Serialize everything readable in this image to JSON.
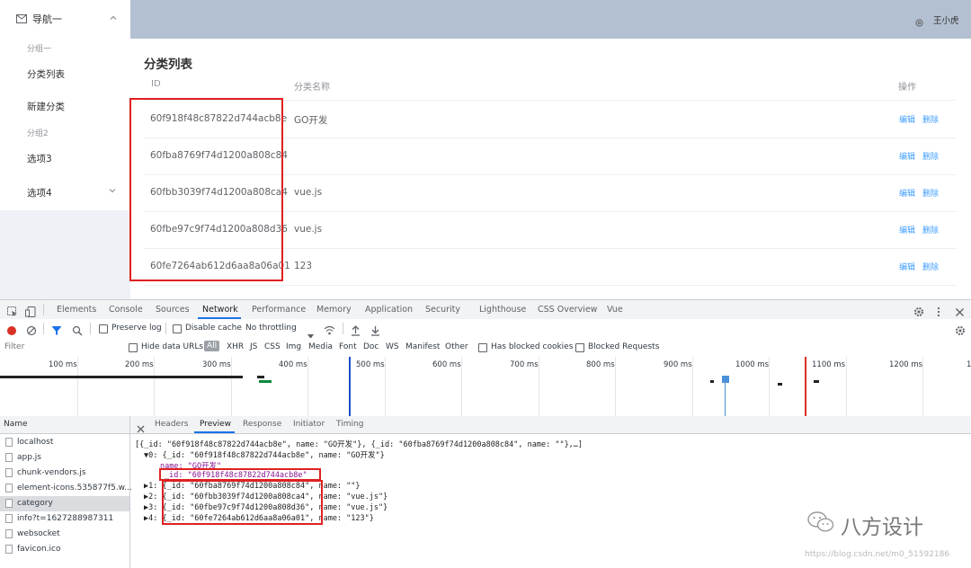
{
  "sidebar": {
    "nav_title": "导航一",
    "group1": "分组一",
    "item_list": "分类列表",
    "item_new": "新建分类",
    "group2": "分组2",
    "item_opt3": "选项3",
    "item_opt4": "选项4"
  },
  "header": {
    "user": "王小虎"
  },
  "main": {
    "title": "分类列表",
    "col_id": "ID",
    "col_name": "分类名称",
    "col_ops": "操作",
    "edit": "编辑",
    "delete": "删除",
    "rows": [
      {
        "id": "60f918f48c87822d744acb8e",
        "name": "GO开发"
      },
      {
        "id": "60fba8769f74d1200a808c84",
        "name": ""
      },
      {
        "id": "60fbb3039f74d1200a808ca4",
        "name": "vue.js"
      },
      {
        "id": "60fbe97c9f74d1200a808d36",
        "name": "vue.js"
      },
      {
        "id": "60fe7264ab612d6aa8a06a01",
        "name": "123"
      }
    ]
  },
  "devtools": {
    "tabs": [
      "Elements",
      "Console",
      "Sources",
      "Network",
      "Performance",
      "Memory",
      "Application",
      "Security",
      "Lighthouse",
      "CSS Overview",
      "Vue"
    ],
    "active_tab": "Network",
    "preserve_log": "Preserve log",
    "disable_cache": "Disable cache",
    "throttling": "No throttling",
    "filter_placeholder": "Filter",
    "hide_data_urls": "Hide data URLs",
    "types": [
      "All",
      "XHR",
      "JS",
      "CSS",
      "Img",
      "Media",
      "Font",
      "Doc",
      "WS",
      "Manifest",
      "Other"
    ],
    "has_blocked_cookies": "Has blocked cookies",
    "blocked_requests": "Blocked Requests",
    "ticks": [
      "100 ms",
      "200 ms",
      "300 ms",
      "400 ms",
      "500 ms",
      "600 ms",
      "700 ms",
      "800 ms",
      "900 ms",
      "1000 ms",
      "1100 ms",
      "1200 ms",
      "1"
    ],
    "name_header": "Name",
    "requests": [
      "localhost",
      "app.js",
      "chunk-vendors.js",
      "element-icons.535877f5.w...",
      "category",
      "info?t=1627288987311",
      "websocket",
      "favicon.ico"
    ],
    "selected_request": "category",
    "preview_tabs": [
      "Headers",
      "Preview",
      "Response",
      "Initiator",
      "Timing"
    ],
    "active_preview_tab": "Preview",
    "preview_lines": [
      "[{_id: \"60f918f48c87822d744acb8e\", name: \"GO开发\"}, {_id: \"60fba8769f74d1200a808c84\", name: \"\"},…]",
      "▼0: {_id: \"60f918f48c87822d744acb8e\", name: \"GO开发\"}",
      "name: \"GO开发\"",
      "_id: \"60f918f48c87822d744acb8e\"",
      "▶1: {_id: \"60fba8769f74d1200a808c84\", name: \"\"}",
      "▶2: {_id: \"60fbb3039f74d1200a808ca4\", name: \"vue.js\"}",
      "▶3: {_id: \"60fbe97c9f74d1200a808d36\", name: \"vue.js\"}",
      "▶4: {_id: \"60fe7264ab612d6aa8a06a01\", name: \"123\"}"
    ]
  },
  "watermark": {
    "brand": "八方设计",
    "url": "https://blog.csdn.net/m0_51592186"
  }
}
